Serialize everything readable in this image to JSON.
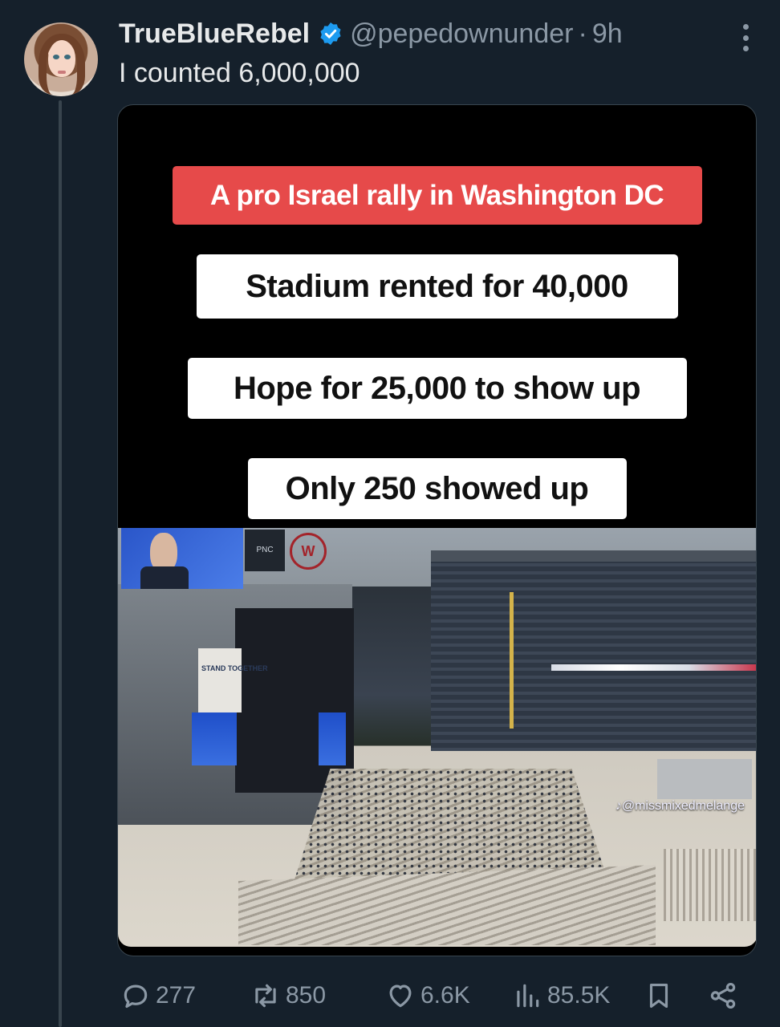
{
  "tweet": {
    "display_name": "TrueBlueRebel",
    "handle": "@pepedownunder",
    "separator": "·",
    "time": "9h",
    "text": "I counted 6,000,000"
  },
  "media": {
    "captions": [
      "A pro Israel rally in Washington DC",
      "Stadium rented for 40,000",
      "Hope for 25,000 to show up",
      "Only 250 showed up"
    ],
    "photo": {
      "banner_text": "STAND TOGETHER",
      "sponsor_sign": "PNC",
      "watermark": "♪@missmixedmelange"
    }
  },
  "actions": {
    "replies": "277",
    "reposts": "850",
    "likes": "6.6K",
    "views": "85.5K"
  },
  "colors": {
    "background": "#15202b",
    "text": "#e7e9ea",
    "secondary": "#8b98a5",
    "verified": "#1d9bf0",
    "caption_red": "#e64a4a"
  }
}
